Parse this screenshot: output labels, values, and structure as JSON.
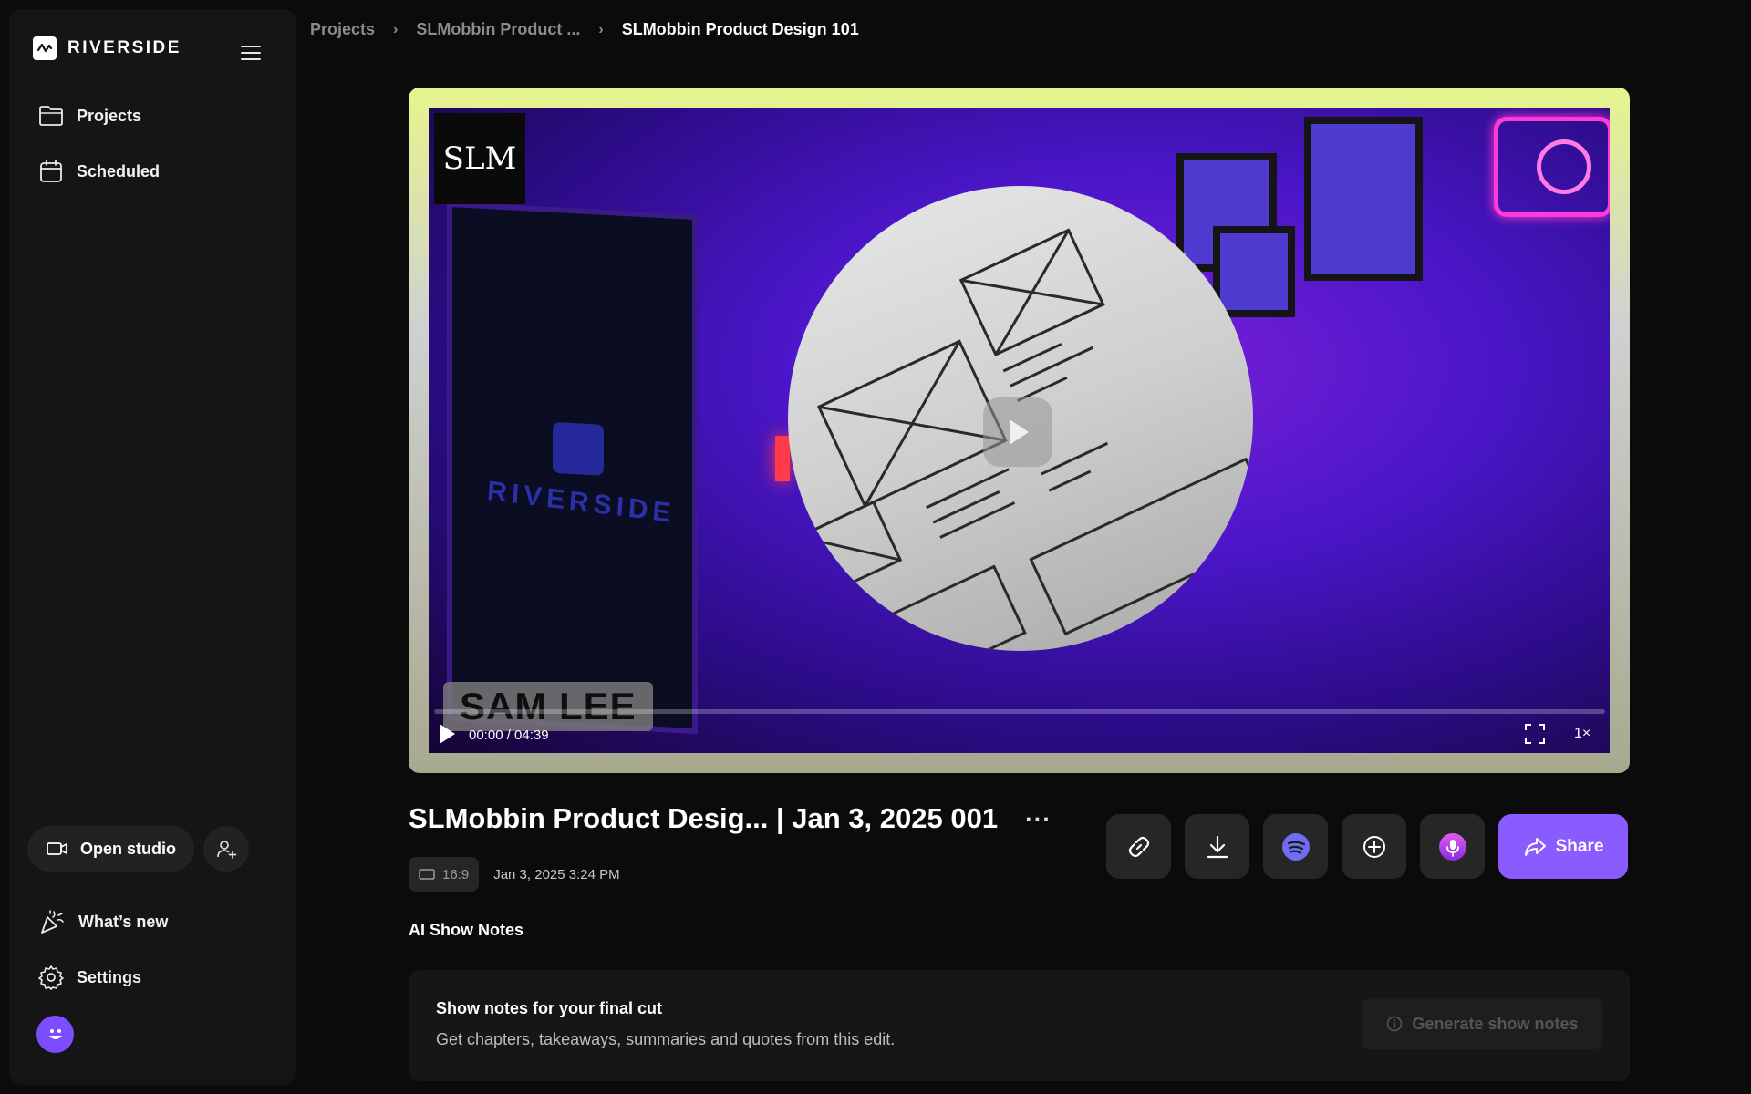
{
  "brand": {
    "name": "RIVERSIDE"
  },
  "sidebar": {
    "items": [
      {
        "label": "Projects",
        "icon": "folder-icon"
      },
      {
        "label": "Scheduled",
        "icon": "calendar-icon"
      }
    ],
    "open_studio_label": "Open studio",
    "bottom_items": [
      {
        "label": "What’s new",
        "icon": "party-popper-icon"
      },
      {
        "label": "Settings",
        "icon": "gear-icon"
      }
    ]
  },
  "breadcrumb": {
    "items": [
      "Projects",
      "SLMobbin Product ...",
      "SLMobbin Product Design 101"
    ],
    "separator": "›"
  },
  "video": {
    "badge_text": "SLM",
    "poster_text": "RIVERSIDE",
    "name_tag": "SAM LEE",
    "time": "00:00 / 04:39",
    "speed": "1×",
    "progress_fraction": 0
  },
  "project": {
    "title": "SLMobbin Product Desig... | Jan 3, 2025 001",
    "more_label": "···",
    "aspect_ratio": "16:9",
    "created": "Jan 3, 2025 3:24 PM"
  },
  "actions": {
    "buttons": [
      {
        "name": "copy-link",
        "icon": "link-icon"
      },
      {
        "name": "download",
        "icon": "download-icon"
      },
      {
        "name": "spotify",
        "icon": "spotify-icon"
      },
      {
        "name": "publish",
        "icon": "plus-circle-icon"
      },
      {
        "name": "podcasts",
        "icon": "podcast-icon"
      }
    ],
    "share_label": "Share"
  },
  "show_notes": {
    "section_title": "AI Show Notes",
    "card_title": "Show notes for your final cut",
    "card_desc": "Get chapters, takeaways, summaries and quotes from this edit.",
    "generate_label": "Generate show notes"
  },
  "colors": {
    "accent": "#8a5cff",
    "background": "#0b0b0b",
    "sidebar": "#151515",
    "spotify": "#1db954",
    "podcasts": "#a83ee8"
  }
}
